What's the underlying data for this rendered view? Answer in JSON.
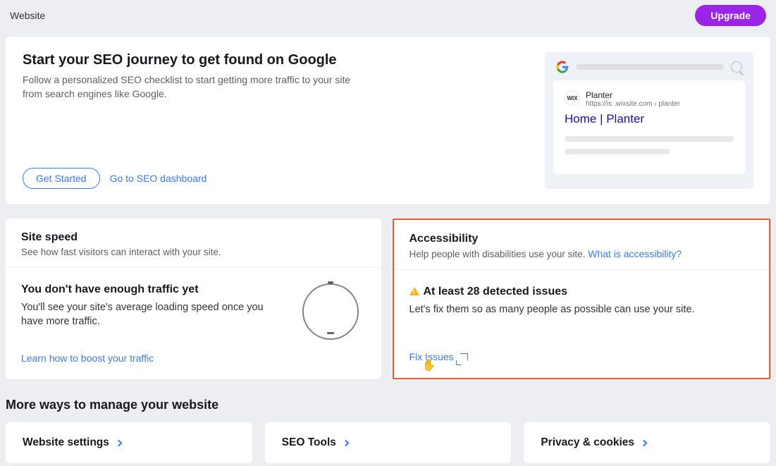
{
  "topbar": {
    "title": "Website",
    "upgrade": "Upgrade"
  },
  "seo": {
    "title": "Start your SEO journey to get found on Google",
    "desc": "Follow a personalized SEO checklist to start getting more traffic to your site from search engines like Google.",
    "get_started": "Get Started",
    "dashboard_link": "Go to SEO dashboard",
    "preview": {
      "sitename": "Planter",
      "url": "https://is            .wixsite.com › planter",
      "result_title": "Home | Planter",
      "favicon_text": "WIX"
    }
  },
  "speed": {
    "title": "Site speed",
    "sub": "See how fast visitors can interact with your site.",
    "msg_title": "You don't have enough traffic yet",
    "msg_desc": "You'll see your site's average loading speed once you have more traffic.",
    "learn_link": "Learn how to boost your traffic"
  },
  "a11y": {
    "title": "Accessibility",
    "sub_prefix": "Help people with disabilities use your site. ",
    "sub_link": "What is accessibility?",
    "msg_title": "At least 28 detected issues",
    "msg_desc": "Let's fix them so as many people as possible can use your site.",
    "fix_link": "Fix Issues"
  },
  "more": {
    "heading": "More ways to manage your website",
    "cards": [
      "Website settings",
      "SEO Tools",
      "Privacy & cookies"
    ]
  }
}
